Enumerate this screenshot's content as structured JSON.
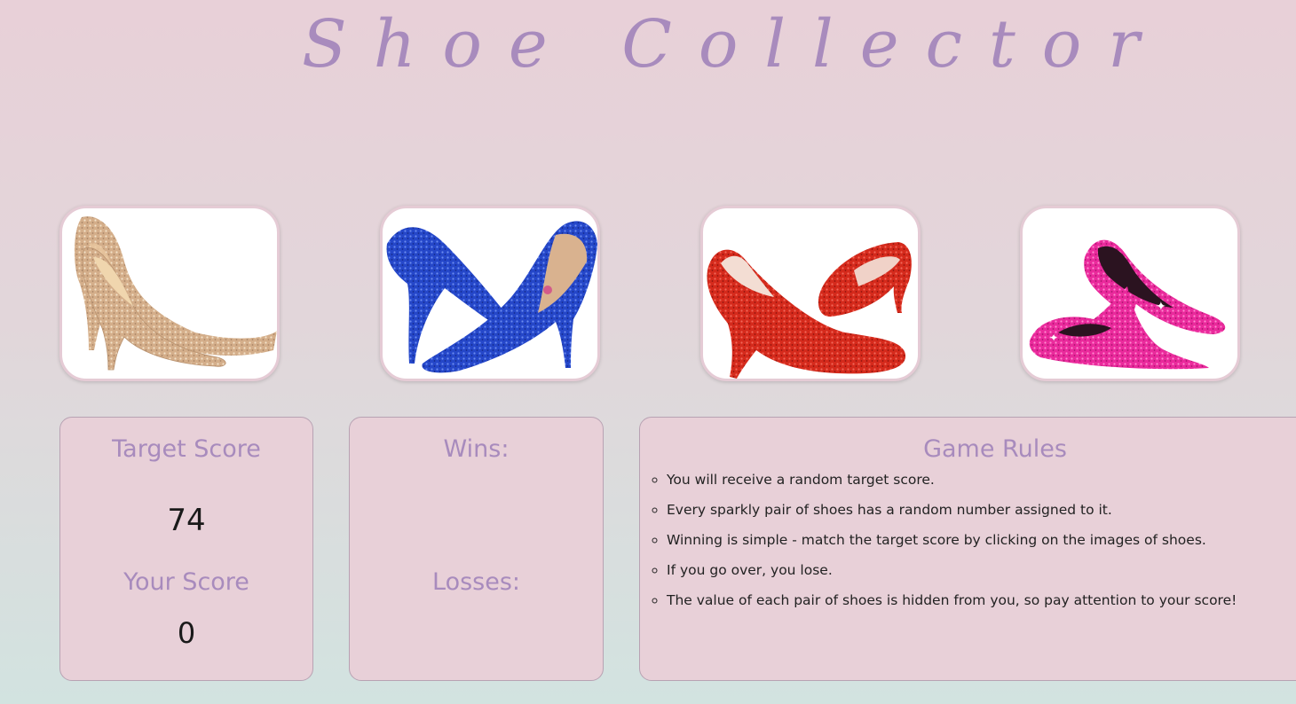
{
  "header": {
    "title": "Shoe Collector"
  },
  "shoes": [
    {
      "name": "gold-glitter-pumps",
      "color": "#d7b48e"
    },
    {
      "name": "blue-glitter-pumps",
      "color": "#2346c8"
    },
    {
      "name": "red-glitter-pumps",
      "color": "#d92a1e"
    },
    {
      "name": "pink-glitter-pumps",
      "color": "#ee2a9e"
    }
  ],
  "scoreboard": {
    "target_label": "Target Score",
    "target_value": "74",
    "your_score_label": "Your Score",
    "your_score_value": "0"
  },
  "record": {
    "wins_label": "Wins:",
    "wins_value": "",
    "losses_label": "Losses:",
    "losses_value": ""
  },
  "rules": {
    "heading": "Game Rules",
    "items": [
      "You will receive a random target score.",
      "Every sparkly pair of shoes has a random number assigned to it.",
      "Winning is simple - match the target score by clicking on the images of shoes.",
      "If you go over, you lose.",
      "The value of each pair of shoes is hidden from you, so pay attention to your score!"
    ]
  },
  "colors": {
    "accent": "#a88bbd",
    "panel_bg": "#e8d0d8",
    "card_border": "#e5cbd5"
  }
}
